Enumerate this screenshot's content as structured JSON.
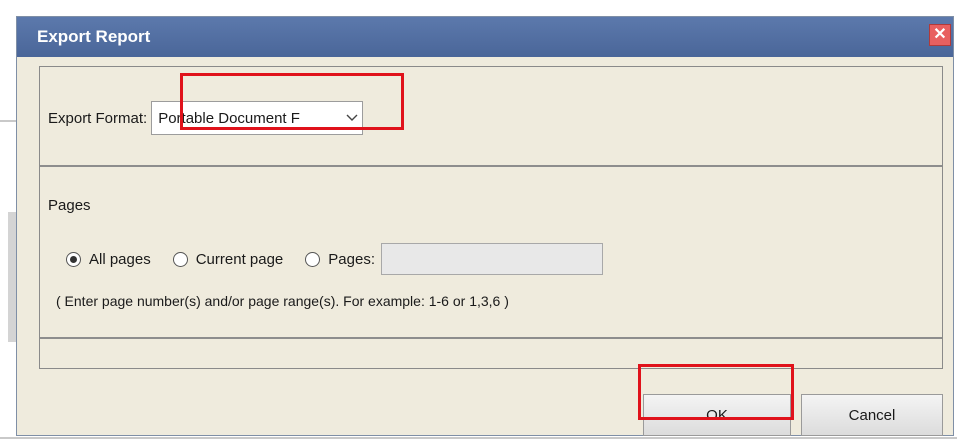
{
  "dialog": {
    "title": "Export Report",
    "close_glyph": "✕",
    "export_format_label": "Export Format:",
    "export_format_value": "Portable Document F",
    "pages_section_title": "Pages",
    "radios": [
      {
        "label": "All pages",
        "selected": true
      },
      {
        "label": "Current page",
        "selected": false
      },
      {
        "label": "Pages:",
        "selected": false
      }
    ],
    "pages_input_value": "",
    "hint": "( Enter page number(s) and/or page range(s). For example: 1-6 or 1,3,6 )",
    "ok_label": "OK",
    "cancel_label": "Cancel"
  },
  "colors": {
    "titlebar": "#4a6699",
    "dialog_bg": "#efebdd",
    "highlight": "#e0121b"
  },
  "icons": {
    "close": "close-icon",
    "dropdown": "chevron-down-icon"
  }
}
